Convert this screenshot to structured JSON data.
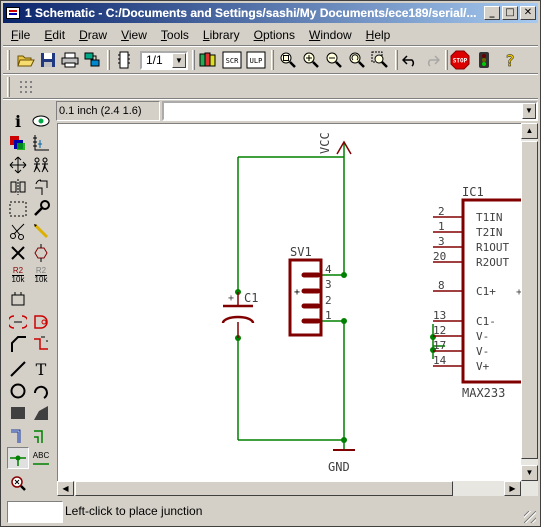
{
  "window": {
    "title": "1 Schematic - C:/Documents and Settings/sashi/My Documents/ece189/serial/...",
    "caption_buttons": [
      "_",
      "□",
      "✕"
    ]
  },
  "menu": [
    {
      "label": "File",
      "key": "F"
    },
    {
      "label": "Edit",
      "key": "E"
    },
    {
      "label": "Draw",
      "key": "D"
    },
    {
      "label": "View",
      "key": "V"
    },
    {
      "label": "Tools",
      "key": "T"
    },
    {
      "label": "Library",
      "key": "L"
    },
    {
      "label": "Options",
      "key": "O"
    },
    {
      "label": "Window",
      "key": "W"
    },
    {
      "label": "Help",
      "key": "H"
    }
  ],
  "toolbar": {
    "sheet_value": "1/1",
    "tools": [
      "open-icon",
      "save-icon",
      "print-icon",
      "cam-processor-icon",
      "board-switch-icon",
      "sheet-select",
      "library-icon",
      "script-icon",
      "ulp-icon",
      "zoom-fit-icon",
      "zoom-in-icon",
      "zoom-out-icon",
      "zoom-redraw-icon",
      "zoom-select-icon",
      "undo-icon",
      "redo-icon",
      "stop-icon",
      "go-icon",
      "help-icon"
    ],
    "stop_label": "STOP",
    "scr_label": "SCR",
    "ulp_label": "ULP"
  },
  "coords": "0.1 inch (2.4 1.6)",
  "command_value": "",
  "left_tools": [
    "info-icon",
    "show-icon",
    "display-icon",
    "mark-icon",
    "move-icon",
    "copy-icon",
    "mirror-icon",
    "rotate-icon",
    "group-icon",
    "change-icon",
    "cut-icon",
    "paste-icon",
    "delete-icon",
    "add-icon",
    "pinswap-icon",
    "gateswap-icon",
    "replace-icon",
    "name-icon",
    "value-icon",
    "smash-icon",
    "miter-icon",
    "split-icon",
    "invoke-icon",
    "label-icon",
    "wire-icon",
    "text-icon",
    "circle-icon",
    "arc-icon",
    "rect-icon",
    "polygon-icon",
    "bus-icon",
    "net-icon",
    "junction-icon",
    "label-abc-icon",
    "erc-icon"
  ],
  "left_labels": {
    "r_label": "R2",
    "r_value": "10k",
    "abc": "ABC"
  },
  "schematic": {
    "vcc": "VCC",
    "gnd": "GND",
    "sv1": "SV1",
    "c1": "C1",
    "ic1": "IC1",
    "ic_value": "MAX233",
    "sv1_pins": [
      "4",
      "3",
      "2",
      "1"
    ],
    "ic_pins_left_nums": [
      "2",
      "1",
      "3",
      "20",
      "8",
      "13",
      "12",
      "17",
      "14"
    ],
    "ic_pins_left_names": [
      "T1IN",
      "T2IN",
      "R1OUT",
      "R2OUT",
      "C1+",
      "C1-",
      "V-",
      "V-",
      "V+"
    ],
    "plus_sign": "+"
  },
  "status": {
    "text": "Left-click to place junction"
  },
  "colors": {
    "net": "#008000",
    "symbol": "#800000",
    "label": "#404040",
    "titlebar_start": "#0a246a",
    "titlebar_end": "#a6caf0"
  }
}
